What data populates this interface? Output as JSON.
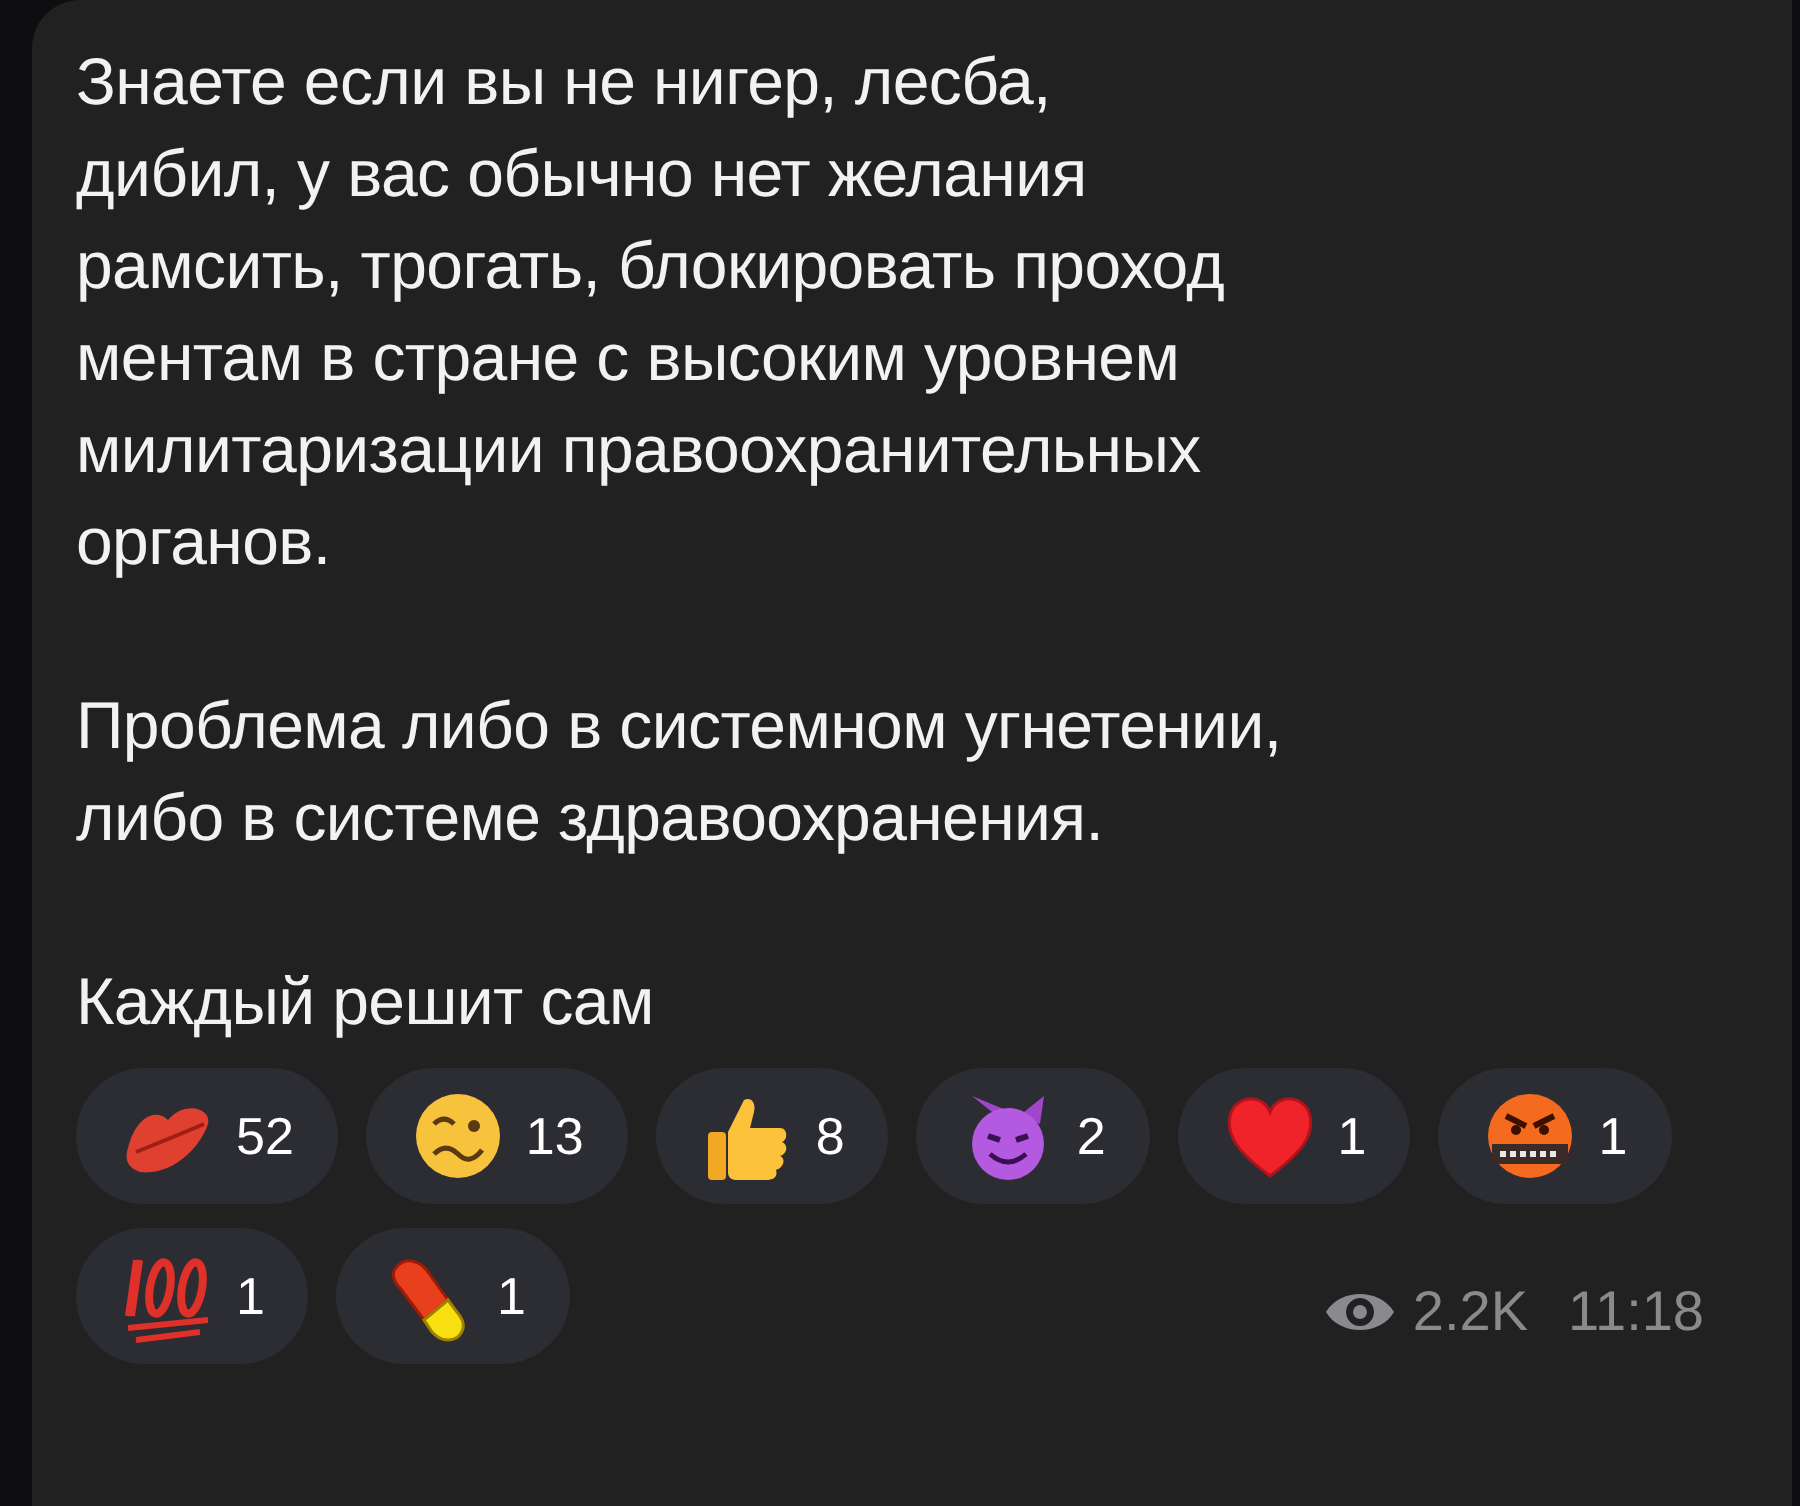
{
  "message": {
    "paragraphs": [
      "Знаете если вы не нигер, лесба,\nдибил, у вас обычно нет желания\nрамсить, трогать, блокировать проход\nментам в стране с высоким уровнем\nмилитаризации правоохранительных\nорганов.",
      "Проблема либо в системном угнетении,\nлибо в системе здравоохранения.",
      "Каждый решит сам"
    ],
    "reactions": [
      {
        "kind": "kiss",
        "count": "52"
      },
      {
        "kind": "woozy",
        "count": "13"
      },
      {
        "kind": "thumbs",
        "count": "8"
      },
      {
        "kind": "devil",
        "count": "2"
      },
      {
        "kind": "heart",
        "count": "1"
      },
      {
        "kind": "cursing",
        "count": "1"
      },
      {
        "kind": "hundred",
        "count": "1"
      },
      {
        "kind": "pill",
        "count": "1"
      }
    ],
    "views": "2.2K",
    "time": "11:18"
  }
}
